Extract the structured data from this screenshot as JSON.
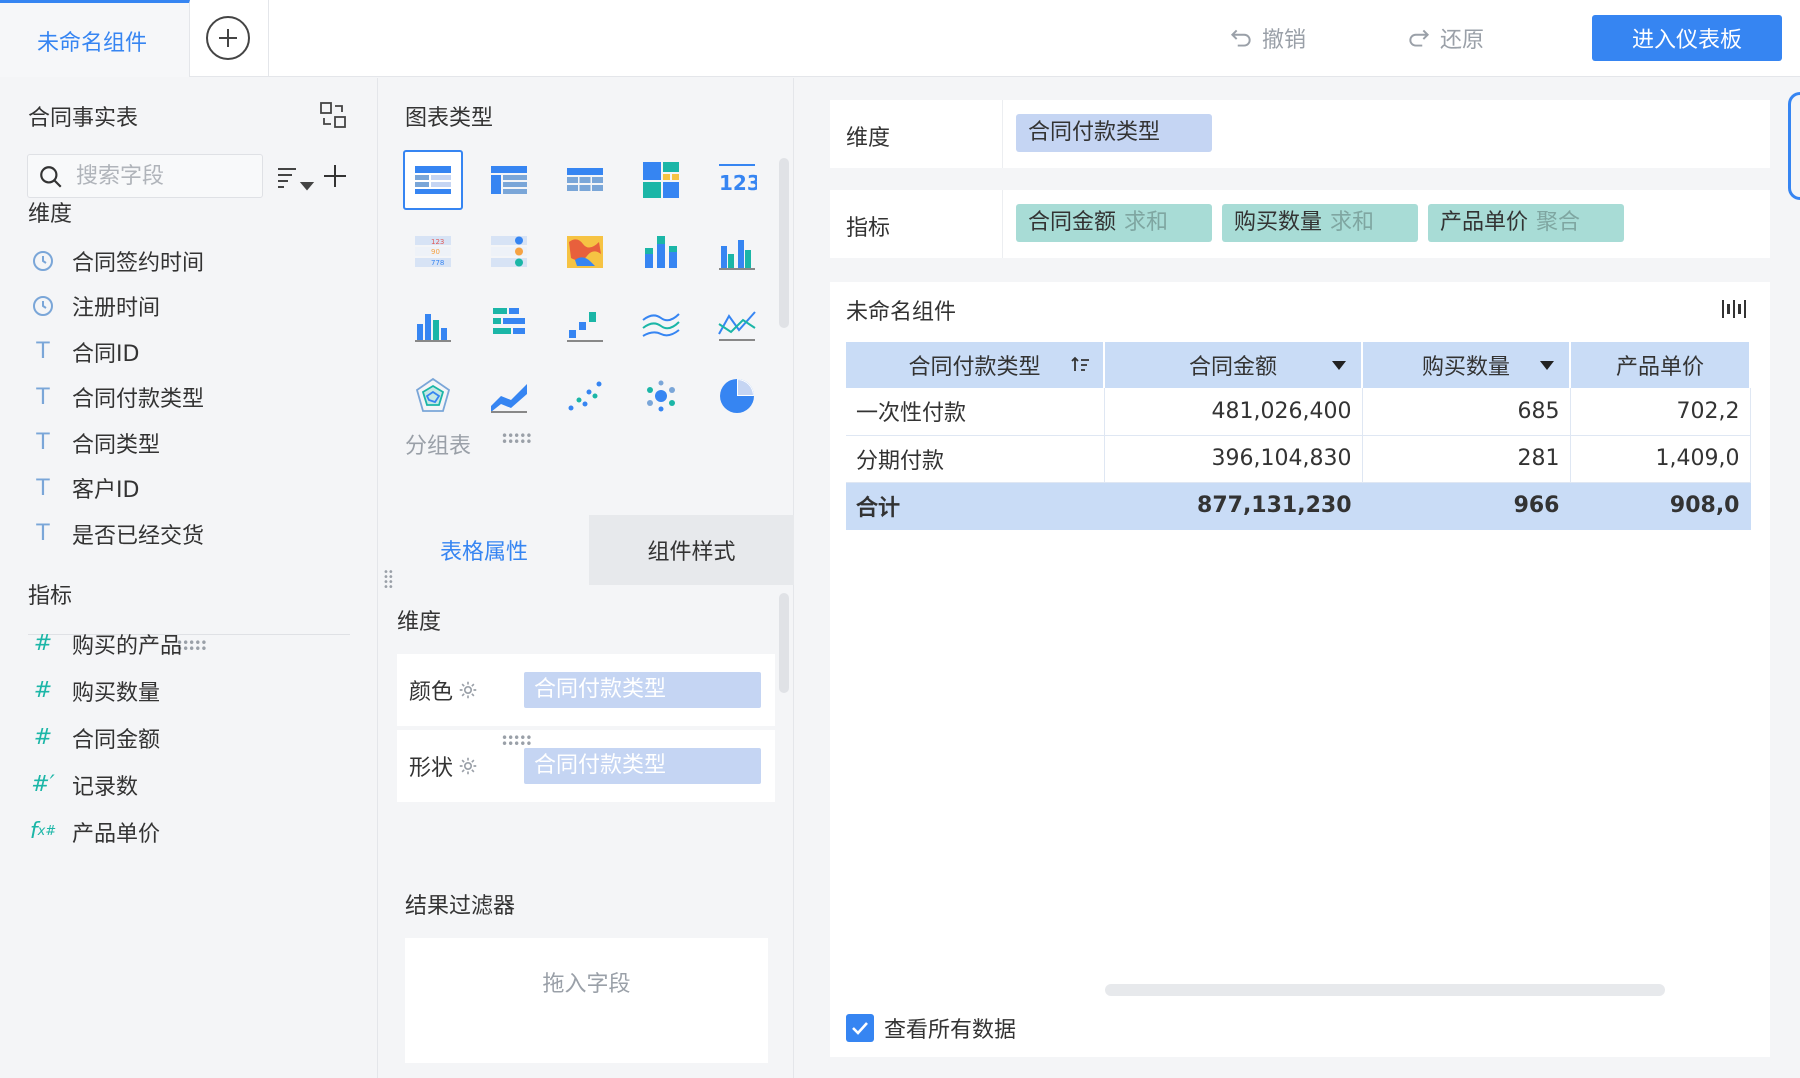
{
  "topbar": {
    "tab_label": "未命名组件",
    "undo_label": "撤销",
    "redo_label": "还原",
    "enter_dashboard_label": "进入仪表板"
  },
  "left": {
    "table_name": "合同事实表",
    "search_placeholder": "搜索字段",
    "dimension_title": "维度",
    "dimensions": [
      {
        "icon": "clock-icon",
        "label": "合同签约时间"
      },
      {
        "icon": "clock-icon",
        "label": "注册时间"
      },
      {
        "icon": "text-type-icon",
        "label": "合同ID"
      },
      {
        "icon": "text-type-icon",
        "label": "合同付款类型"
      },
      {
        "icon": "text-type-icon",
        "label": "合同类型"
      },
      {
        "icon": "text-type-icon",
        "label": "客户ID"
      },
      {
        "icon": "text-type-icon",
        "label": "是否已经交货"
      }
    ],
    "metric_title": "指标",
    "metrics": [
      {
        "icon": "number-type-icon",
        "label": "购买的产品"
      },
      {
        "icon": "number-type-icon",
        "label": "购买数量"
      },
      {
        "icon": "number-type-icon",
        "label": "合同金额"
      },
      {
        "icon": "record-count-icon",
        "label": "记录数"
      },
      {
        "icon": "formula-icon",
        "label": "产品单价"
      }
    ]
  },
  "middle": {
    "chart_types_title": "图表类型",
    "selected_chart_name": "分组表",
    "tab_properties": "表格属性",
    "tab_style": "组件样式",
    "props_dimension_title": "维度",
    "color_label": "颜色",
    "color_value": "合同付款类型",
    "shape_label": "形状",
    "shape_value": "合同付款类型",
    "filter_title": "结果过滤器",
    "filter_drop_hint": "拖入字段"
  },
  "right": {
    "dimension_label": "维度",
    "dimension_chip": "合同付款类型",
    "metric_label": "指标",
    "metric_chips": [
      {
        "name": "合同金额",
        "agg": "求和"
      },
      {
        "name": "购买数量",
        "agg": "求和"
      },
      {
        "name": "产品单价",
        "agg": "聚合"
      }
    ],
    "widget_title": "未命名组件",
    "table": {
      "headers": [
        "合同付款类型",
        "合同金额",
        "购买数量",
        "产品单价"
      ],
      "rows": [
        [
          "一次性付款",
          "481,026,400",
          "685",
          "702,2"
        ],
        [
          "分期付款",
          "396,104,830",
          "281",
          "1,409,0"
        ]
      ],
      "total": [
        "合计",
        "877,131,230",
        "966",
        "908,0"
      ]
    },
    "view_all_label": "查看所有数据"
  },
  "colors": {
    "accent": "#3685f2",
    "dimension_chip": "#c5d5f3",
    "metric_chip": "#a8dcd6",
    "table_header": "#c9dcf6"
  }
}
